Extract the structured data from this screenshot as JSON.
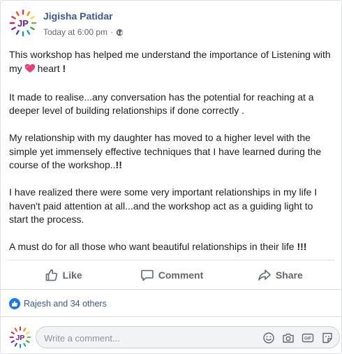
{
  "post": {
    "author": "Jigisha Patidar",
    "avatar_initials": "JP",
    "timestamp": "Today at 6:00 pm",
    "separator": "·",
    "privacy_icon": "globe-icon",
    "paragraphs": {
      "p1_a": "This workshop has helped me understand the importance of Listening with my",
      "p1_b": "heart",
      "p1_c": "!",
      "p2": "It made to realise...any conversation has the potential for reaching at a deeper level of building relationships if done correctly .",
      "p3_a": "My relationship with my daughter has moved to a higher level with the simple yet immensely effective techniques that I have learned during the course of the workshop..",
      "p3_b": "!!",
      "p4": "I have realized there were some very important relationships in my life I haven't paid attention at all...and the workshop act as a guiding light to start the process.",
      "p5_a": "A must do for all those who want beautiful relationships in their life",
      "p5_b": "!!!"
    },
    "emoji": "sparkling-heart"
  },
  "actions": {
    "like": "Like",
    "comment": "Comment",
    "share": "Share"
  },
  "reactions": {
    "text": "Rajesh and 34 others"
  },
  "comment_input": {
    "placeholder": "Write a comment...",
    "tools": [
      "emoji-icon",
      "camera-icon",
      "gif-icon",
      "sticker-icon"
    ]
  },
  "colors": {
    "link": "#385898",
    "secondary": "#606770",
    "like_blue": "#1877f2",
    "heart_pink": "#e8416f"
  }
}
